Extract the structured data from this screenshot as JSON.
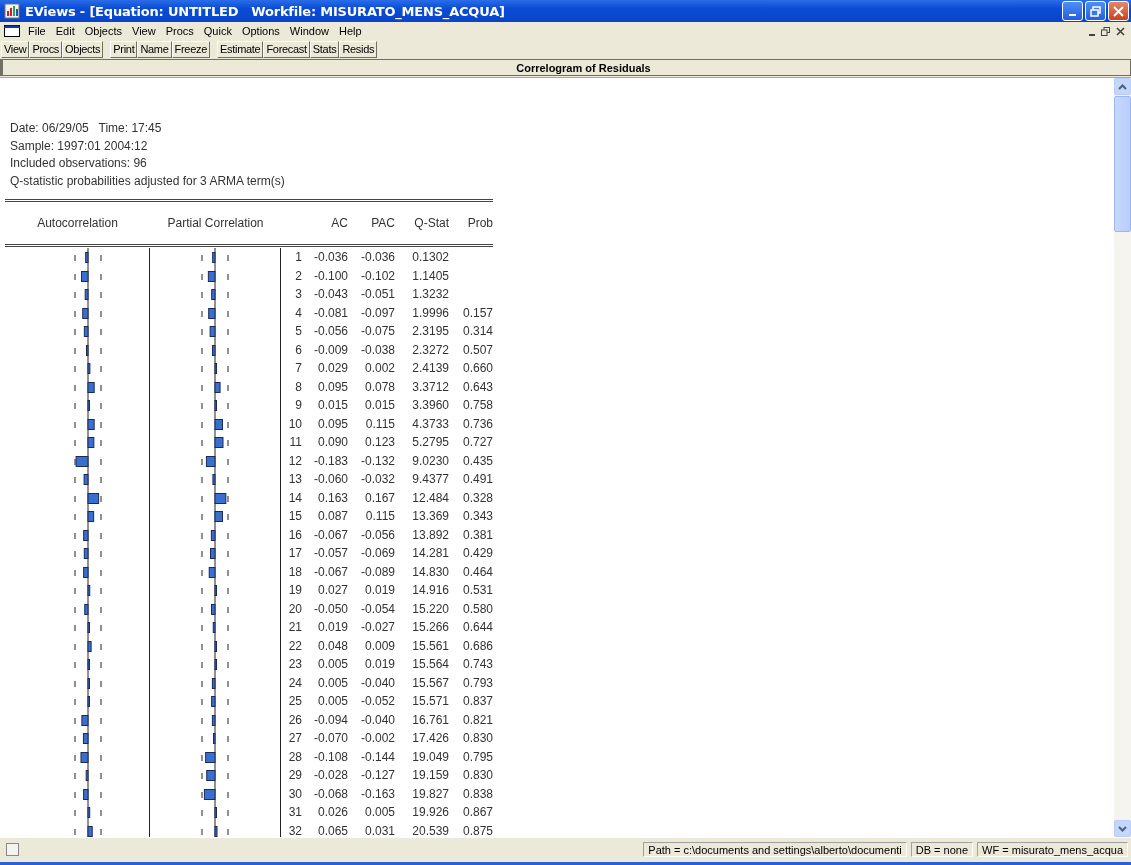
{
  "window": {
    "title": "EViews - [Equation: UNTITLED   Workfile: MISURATO_MENS_ACQUA]"
  },
  "menu": [
    "File",
    "Edit",
    "Objects",
    "View",
    "Procs",
    "Quick",
    "Options",
    "Window",
    "Help"
  ],
  "toolbar": [
    [
      "View",
      "Procs",
      "Objects"
    ],
    [
      "Print",
      "Name",
      "Freeze"
    ],
    [
      "Estimate",
      "Forecast",
      "Stats",
      "Resids"
    ]
  ],
  "view_header": "Correlogram of Residuals",
  "info_lines": [
    "Date: 06/29/05   Time: 17:45",
    "Sample: 1997:01 2004:12",
    "Included observations: 96",
    "Q-statistic probabilities adjusted for 3 ARMA term(s)"
  ],
  "table": {
    "columns": [
      "Autocorrelation",
      "Partial Correlation",
      "AC",
      "PAC",
      "Q-Stat",
      "Prob"
    ],
    "rows": [
      {
        "lag": "1",
        "ac": "-0.036",
        "pac": "-0.036",
        "q_stat": "0.1302"
      },
      {
        "lag": "2",
        "ac": "-0.100",
        "pac": "-0.102",
        "q_stat": "1.1405"
      },
      {
        "lag": "3",
        "ac": "-0.043",
        "pac": "-0.051",
        "q_stat": "1.3232"
      },
      {
        "lag": "4",
        "ac": "-0.081",
        "pac": "-0.097",
        "q_stat": "1.9996",
        "prob": "0.157"
      },
      {
        "lag": "5",
        "ac": "-0.056",
        "pac": "-0.075",
        "q_stat": "2.3195",
        "prob": "0.314"
      },
      {
        "lag": "6",
        "ac": "-0.009",
        "pac": "-0.038",
        "q_stat": "2.3272",
        "prob": "0.507"
      },
      {
        "lag": "7",
        "ac": "0.029",
        "pac": "0.002",
        "q_stat": "2.4139",
        "prob": "0.660"
      },
      {
        "lag": "8",
        "ac": "0.095",
        "pac": "0.078",
        "q_stat": "3.3712",
        "prob": "0.643"
      },
      {
        "lag": "9",
        "ac": "0.015",
        "pac": "0.015",
        "q_stat": "3.3960",
        "prob": "0.758"
      },
      {
        "lag": "10",
        "ac": "0.095",
        "pac": "0.115",
        "q_stat": "4.3733",
        "prob": "0.736"
      },
      {
        "lag": "11",
        "ac": "0.090",
        "pac": "0.123",
        "q_stat": "5.2795",
        "prob": "0.727"
      },
      {
        "lag": "12",
        "ac": "-0.183",
        "pac": "-0.132",
        "q_stat": "9.0230",
        "prob": "0.435"
      },
      {
        "lag": "13",
        "ac": "-0.060",
        "pac": "-0.032",
        "q_stat": "9.4377",
        "prob": "0.491"
      },
      {
        "lag": "14",
        "ac": "0.163",
        "pac": "0.167",
        "q_stat": "12.484",
        "prob": "0.328"
      },
      {
        "lag": "15",
        "ac": "0.087",
        "pac": "0.115",
        "q_stat": "13.369",
        "prob": "0.343"
      },
      {
        "lag": "16",
        "ac": "-0.067",
        "pac": "-0.056",
        "q_stat": "13.892",
        "prob": "0.381"
      },
      {
        "lag": "17",
        "ac": "-0.057",
        "pac": "-0.069",
        "q_stat": "14.281",
        "prob": "0.429"
      },
      {
        "lag": "18",
        "ac": "-0.067",
        "pac": "-0.089",
        "q_stat": "14.830",
        "prob": "0.464"
      },
      {
        "lag": "19",
        "ac": "0.027",
        "pac": "0.019",
        "q_stat": "14.916",
        "prob": "0.531"
      },
      {
        "lag": "20",
        "ac": "-0.050",
        "pac": "-0.054",
        "q_stat": "15.220",
        "prob": "0.580"
      },
      {
        "lag": "21",
        "ac": "0.019",
        "pac": "-0.027",
        "q_stat": "15.266",
        "prob": "0.644"
      },
      {
        "lag": "22",
        "ac": "0.048",
        "pac": "0.009",
        "q_stat": "15.561",
        "prob": "0.686"
      },
      {
        "lag": "23",
        "ac": "0.005",
        "pac": "0.019",
        "q_stat": "15.564",
        "prob": "0.743"
      },
      {
        "lag": "24",
        "ac": "0.005",
        "pac": "-0.040",
        "q_stat": "15.567",
        "prob": "0.793"
      },
      {
        "lag": "25",
        "ac": "0.005",
        "pac": "-0.052",
        "q_stat": "15.571",
        "prob": "0.837"
      },
      {
        "lag": "26",
        "ac": "-0.094",
        "pac": "-0.040",
        "q_stat": "16.761",
        "prob": "0.821"
      },
      {
        "lag": "27",
        "ac": "-0.070",
        "pac": "-0.002",
        "q_stat": "17.426",
        "prob": "0.830"
      },
      {
        "lag": "28",
        "ac": "-0.108",
        "pac": "-0.144",
        "q_stat": "19.049",
        "prob": "0.795"
      },
      {
        "lag": "29",
        "ac": "-0.028",
        "pac": "-0.127",
        "q_stat": "19.159",
        "prob": "0.830"
      },
      {
        "lag": "30",
        "ac": "-0.068",
        "pac": "-0.163",
        "q_stat": "19.827",
        "prob": "0.838"
      },
      {
        "lag": "31",
        "ac": "0.026",
        "pac": "0.005",
        "q_stat": "19.926",
        "prob": "0.867"
      },
      {
        "lag": "32",
        "ac": "0.065",
        "pac": "0.031",
        "q_stat": "20.539",
        "prob": "0.875"
      }
    ]
  },
  "status_bar": [
    "Path = c:\\documents and settings\\alberto\\documenti",
    "DB = none",
    "WF = misurato_mens_acqua"
  ]
}
